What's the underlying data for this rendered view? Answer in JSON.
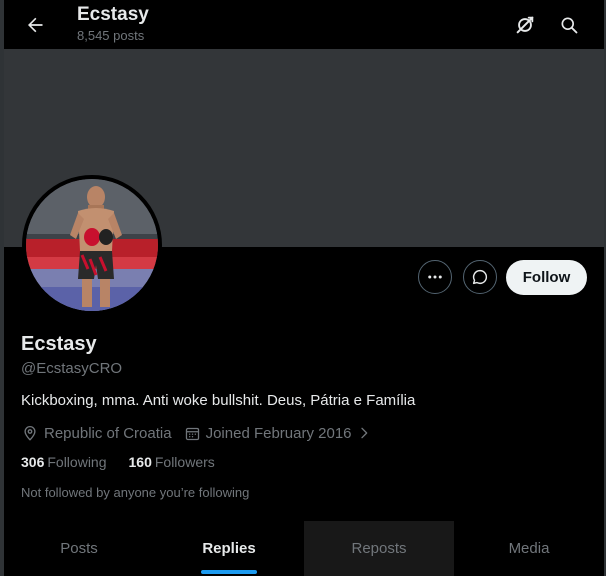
{
  "header": {
    "back_icon": "arrow-left-icon",
    "title": "Ecstasy",
    "posts_count": "8,545 posts",
    "grok_icon": "grok-icon",
    "search_icon": "search-icon"
  },
  "colors": {
    "background": "#000000",
    "banner": "#333639",
    "primary_text": "#e7e9ea",
    "secondary_text": "#71767b",
    "accent": "#1d9bf0",
    "follow_bg": "#eff3f4"
  },
  "actions": {
    "more_icon": "more-horizontal-icon",
    "message_icon": "message-icon",
    "follow_label": "Follow"
  },
  "profile": {
    "display_name": "Ecstasy",
    "handle": "@EcstasyCRO",
    "bio": "Kickboxing, mma. Anti woke bullshit.  Deus, Pátria e Família",
    "location": "Republic of Croatia",
    "joined": "Joined February 2016",
    "following_count": "306",
    "following_label": "Following",
    "followers_count": "160",
    "followers_label": "Followers",
    "not_followed": "Not followed by anyone you’re following"
  },
  "tabs": [
    {
      "label": "Posts",
      "active": false
    },
    {
      "label": "Replies",
      "active": true
    },
    {
      "label": "Reposts",
      "active": false
    },
    {
      "label": "Media",
      "active": false
    }
  ]
}
